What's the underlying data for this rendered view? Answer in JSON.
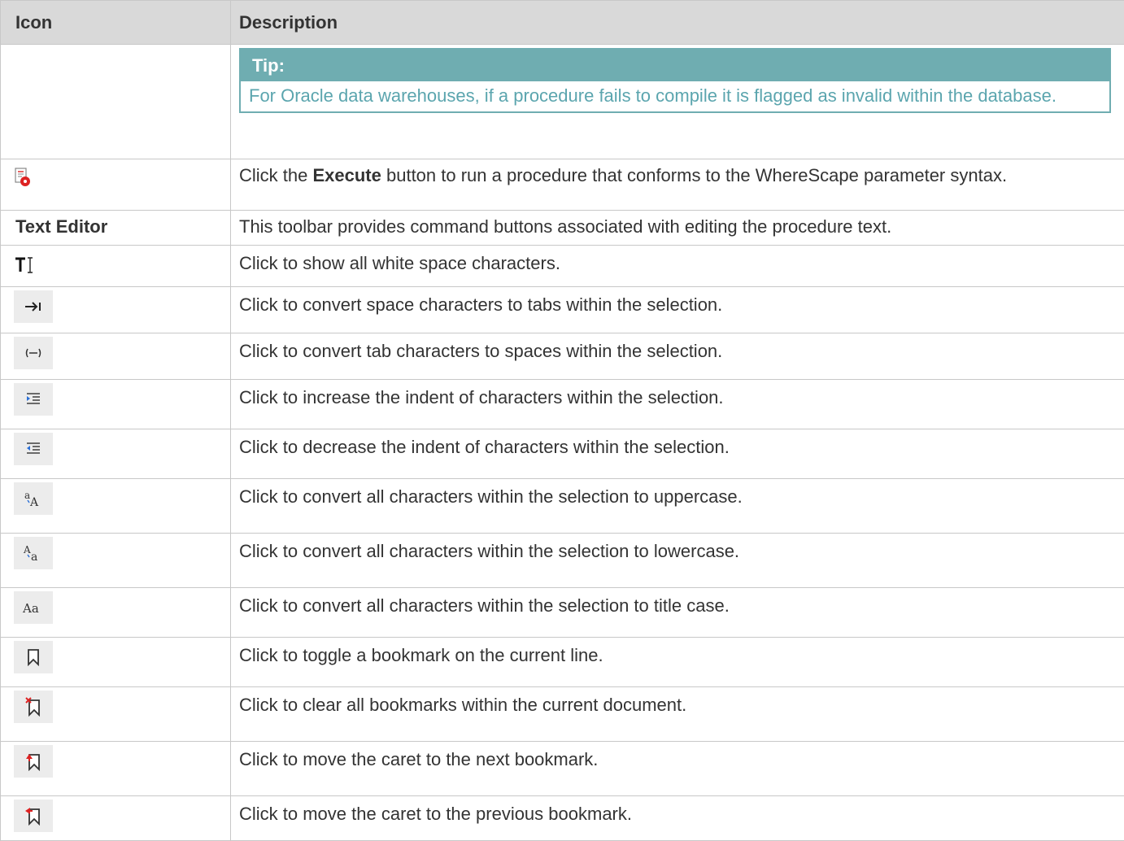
{
  "header": {
    "icon": "Icon",
    "description": "Description"
  },
  "tip": {
    "title": "Tip:",
    "text": "For Oracle data warehouses, if a procedure fails to compile it is flagged as invalid within the database."
  },
  "execute_row": {
    "icon": "execute-procedure-icon",
    "before": "Click the ",
    "bold": "Execute",
    "after": " button to run a procedure that conforms to the WhereScape parameter syntax."
  },
  "text_editor_row": {
    "label": "Text Editor",
    "description": "This toolbar provides command buttons associated with editing the procedure text."
  },
  "rows": [
    {
      "icon": "show-whitespace-icon",
      "glyph": "T⌶",
      "description": "Click to show all white space characters."
    },
    {
      "icon": "spaces-to-tabs-icon",
      "glyph": "→I",
      "description": "Click to convert space characters to tabs within the selection."
    },
    {
      "icon": "tabs-to-spaces-icon",
      "glyph": "(—)",
      "description": "Click to convert tab characters to spaces within the selection."
    },
    {
      "icon": "increase-indent-icon",
      "glyph": "",
      "description": "Click to increase the indent of characters within the selection."
    },
    {
      "icon": "decrease-indent-icon",
      "glyph": "",
      "description": "Click to decrease the indent of characters within the selection."
    },
    {
      "icon": "uppercase-icon",
      "glyph": "ᵃA",
      "description": "Click to convert all characters within the selection to uppercase."
    },
    {
      "icon": "lowercase-icon",
      "glyph": "ᴬa",
      "description": "Click to convert all characters within the selection to lowercase."
    },
    {
      "icon": "titlecase-icon",
      "glyph": "Aa",
      "description": "Click to convert all characters within the selection to title case."
    },
    {
      "icon": "toggle-bookmark-icon",
      "glyph": "",
      "description": "Click to toggle a bookmark on the current line."
    },
    {
      "icon": "clear-bookmarks-icon",
      "glyph": "",
      "description": "Click to clear all bookmarks within the current document."
    },
    {
      "icon": "next-bookmark-icon",
      "glyph": "",
      "description": "Click to move the caret to the next bookmark."
    },
    {
      "icon": "previous-bookmark-icon",
      "glyph": "",
      "description": "Click to move the caret to the previous bookmark."
    }
  ],
  "colors": {
    "header_bg": "#d9d9d9",
    "tip_accent": "#6fadb1",
    "tip_text": "#5ba5ae",
    "border": "#c8c8c8"
  }
}
